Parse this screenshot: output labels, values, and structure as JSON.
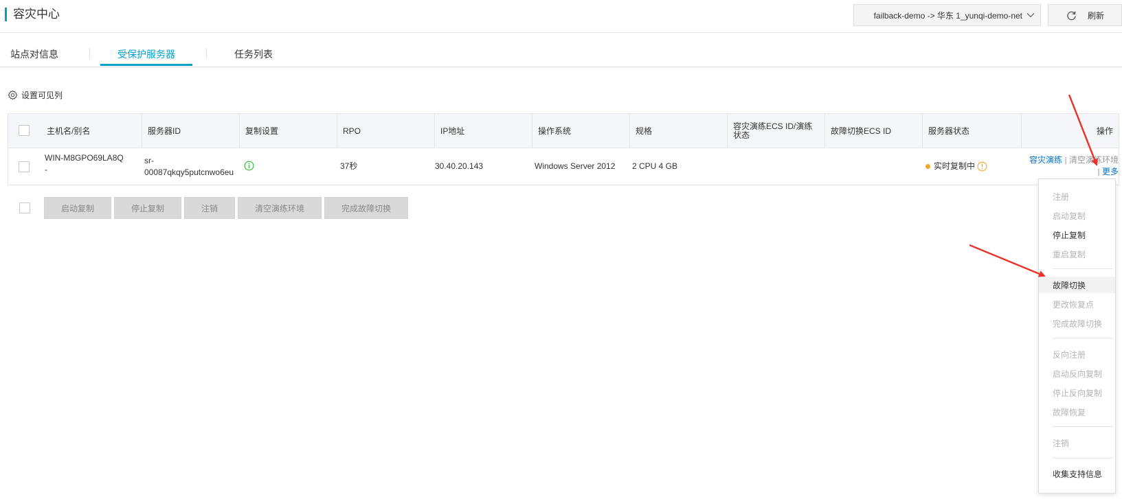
{
  "header": {
    "title": "容灾中心",
    "env_selected": "failback-demo -> 华东 1_yunqi-demo-net",
    "refresh_label": "刷新"
  },
  "tabs": [
    {
      "label": "站点对信息",
      "active": false
    },
    {
      "label": "受保护服务器",
      "active": true
    },
    {
      "label": "任务列表",
      "active": false
    }
  ],
  "settings_label": "设置可见列",
  "table": {
    "columns": [
      "主机名/别名",
      "服务器ID",
      "复制设置",
      "RPO",
      "IP地址",
      "操作系统",
      "规格",
      "容灾演练ECS ID/演练状态",
      "故障切换ECS ID",
      "服务器状态",
      "操作"
    ],
    "rows": [
      {
        "hostname_line1": "WIN-M8GPO69LA8Q",
        "hostname_line2": "-",
        "server_id_line1": "sr-",
        "server_id_line2": "00087qkqy5putcnwo6eu",
        "rpo": "37秒",
        "ip": "30.40.20.143",
        "os": "Windows Server 2012",
        "spec": "2 CPU 4 GB",
        "drill_ecs": "",
        "failover_ecs": "",
        "status": "实时复制中",
        "actions": {
          "drill": "容灾演练",
          "separator": "|",
          "clear": "清空演练环境",
          "more": "更多"
        }
      }
    ]
  },
  "bulk_actions": [
    "启动复制",
    "停止复制",
    "注销",
    "清空演练环境",
    "完成故障切换"
  ],
  "more_menu": [
    {
      "label": "注册",
      "enabled": false
    },
    {
      "label": "启动复制",
      "enabled": false
    },
    {
      "label": "停止复制",
      "enabled": true
    },
    {
      "label": "重启复制",
      "enabled": false
    },
    {
      "label": "故障切换",
      "enabled": true,
      "highlight": true
    },
    {
      "label": "更改恢复点",
      "enabled": false
    },
    {
      "label": "完成故障切换",
      "enabled": false
    },
    {
      "label": "反向注册",
      "enabled": false
    },
    {
      "label": "启动反向复制",
      "enabled": false
    },
    {
      "label": "停止反向复制",
      "enabled": false
    },
    {
      "label": "故障恢复",
      "enabled": false
    },
    {
      "label": "注销",
      "enabled": false
    },
    {
      "label": "收集支持信息",
      "enabled": true
    }
  ],
  "colors": {
    "accent": "#00a2ca",
    "link": "#0070cc",
    "status_warning": "#f5a623",
    "info_green": "#2eb82e",
    "annotation_arrow": "#e8322b"
  },
  "icons": {
    "refresh": "refresh-icon",
    "settings": "gear-icon",
    "replication_info": "info-circle-icon",
    "status_warning": "warning-circle-icon",
    "select_chevron": "chevron-down-icon"
  }
}
